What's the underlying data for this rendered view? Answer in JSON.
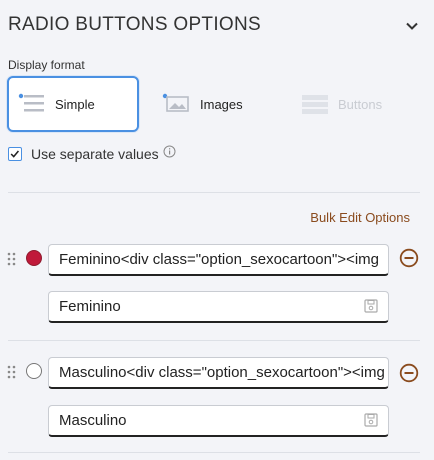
{
  "section": {
    "title": "RADIO BUTTONS OPTIONS"
  },
  "display_format": {
    "label": "Display format",
    "options": [
      {
        "label": "Simple",
        "selected": true
      },
      {
        "label": "Images",
        "selected": false
      },
      {
        "label": "Buttons",
        "selected": false,
        "disabled": true
      }
    ]
  },
  "separate_values": {
    "label": "Use separate values",
    "checked": true
  },
  "bulk_edit": {
    "label": "Bulk Edit Options"
  },
  "options": [
    {
      "label": "Feminino<div class=\"option_sexocartoon\"><img",
      "value": "Feminino",
      "default": true
    },
    {
      "label": "Masculino<div class=\"option_sexocartoon\"><img",
      "value": "Masculino",
      "default": false
    }
  ],
  "colors": {
    "accent_blue": "#4a90e2",
    "link_brown": "#8a4b1e",
    "selected_radio": "#c0193a"
  }
}
